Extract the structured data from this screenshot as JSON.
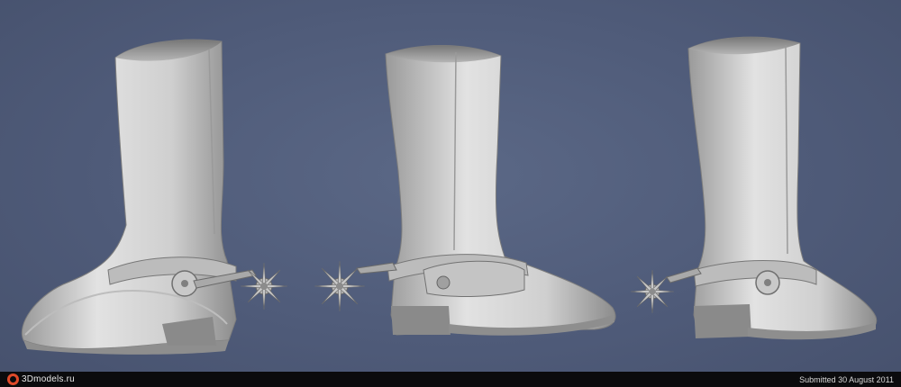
{
  "scene": {
    "subject": "three-view render of a cowboy boot with spur",
    "background_color": "#4f5b79",
    "model_color": "#cfcfcf"
  },
  "footer": {
    "logo_text": "3Dmodels.ru",
    "submitted_text": "Submitted 30 August 2011"
  }
}
